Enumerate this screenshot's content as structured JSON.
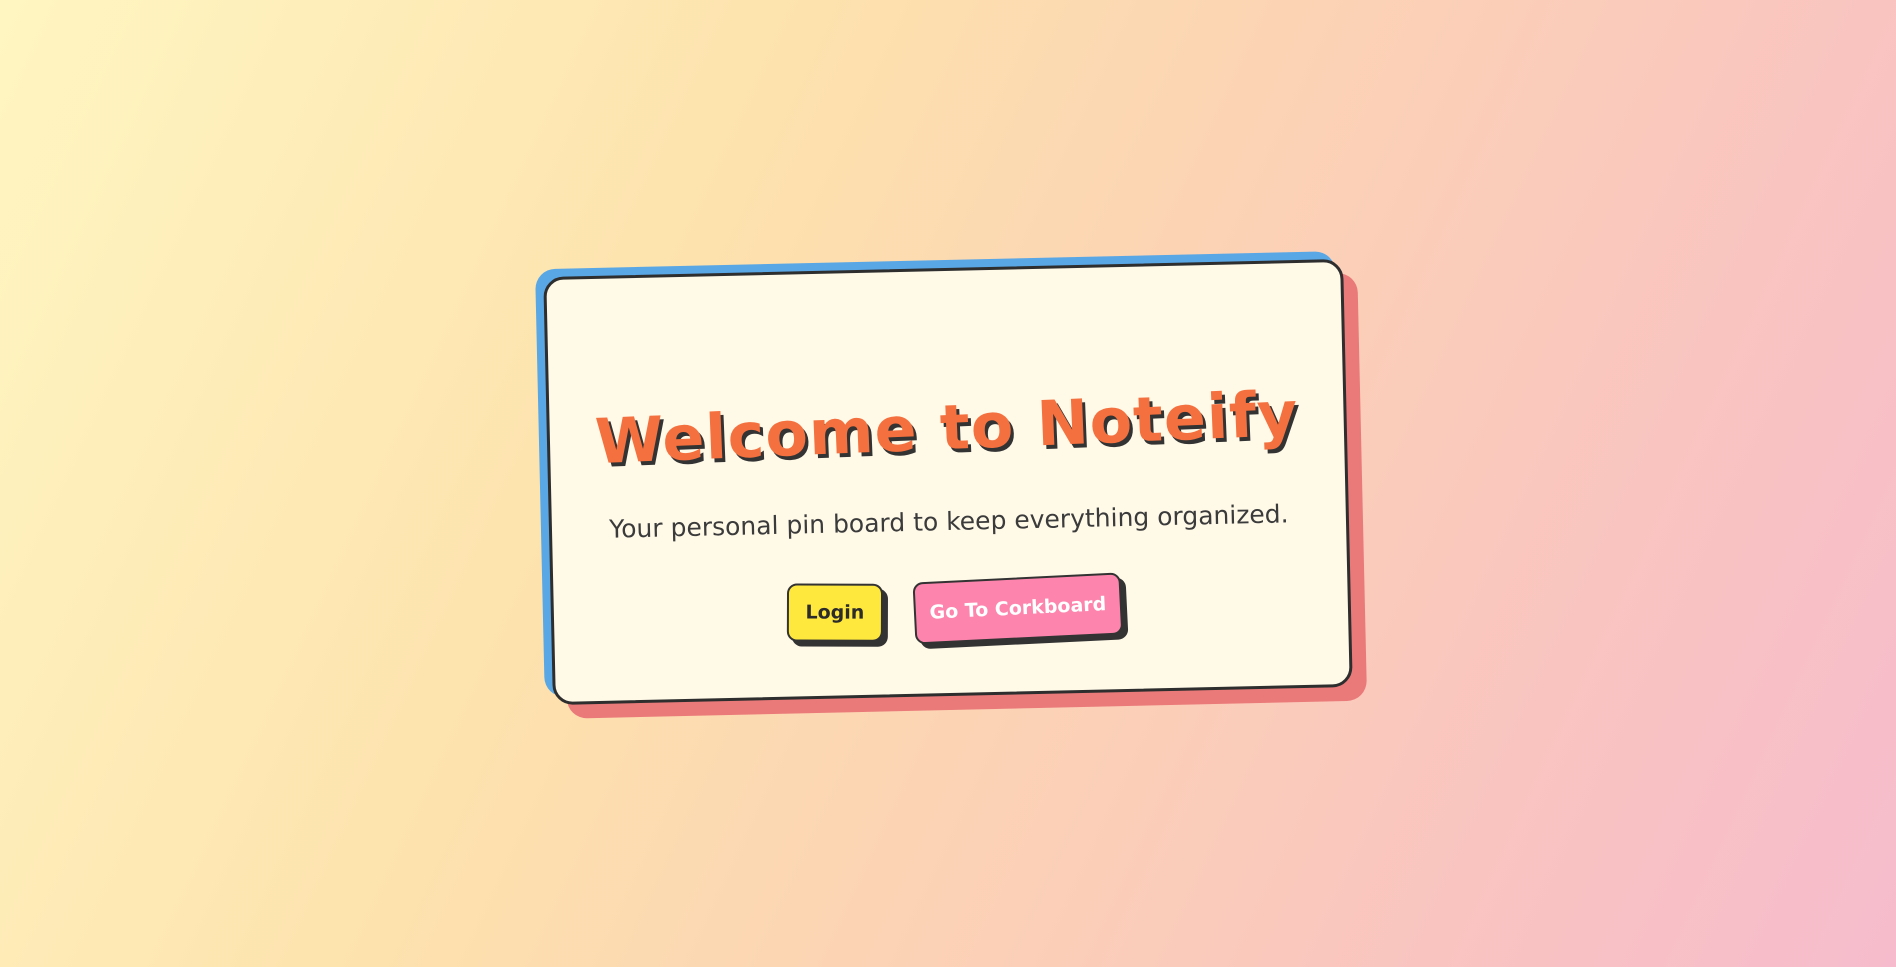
{
  "hero": {
    "title": "Welcome to Noteify",
    "subtitle": "Your personal pin board to keep everything organized."
  },
  "actions": {
    "login_label": "Login",
    "corkboard_label": "Go To Corkboard"
  },
  "colors": {
    "title": "#f4703e",
    "login_button": "#ffe83d",
    "corkboard_button": "#fd85ad",
    "card_background": "#fff9e8",
    "card_accent_blue": "#5aa7e6",
    "card_accent_red": "#ea7a7a"
  }
}
